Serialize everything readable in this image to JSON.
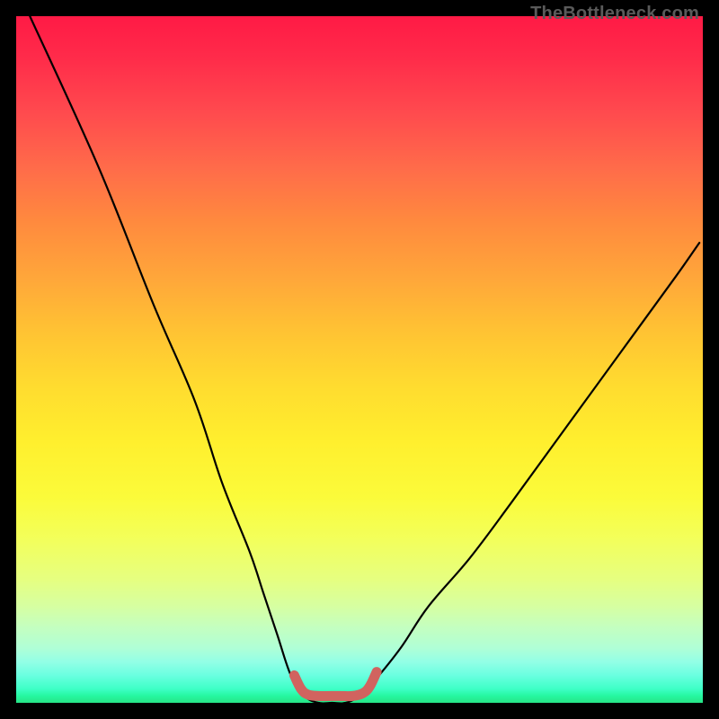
{
  "watermark": "TheBottleneck.com",
  "chart_data": {
    "type": "line",
    "title": "",
    "xlabel": "",
    "ylabel": "",
    "xlim": [
      0,
      100
    ],
    "ylim": [
      0,
      100
    ],
    "grid": false,
    "series": [
      {
        "name": "bottleneck-curve",
        "x": [
          2,
          12,
          20,
          26,
          30,
          34,
          36,
          38,
          40,
          42,
          44,
          46,
          48,
          50,
          52,
          56,
          60,
          66,
          72,
          80,
          88,
          96,
          99.5
        ],
        "y": [
          100,
          78,
          58,
          44,
          32,
          22,
          16,
          10,
          4,
          1,
          0,
          0,
          0,
          1,
          3,
          8,
          14,
          21,
          29,
          40,
          51,
          62,
          67
        ]
      },
      {
        "name": "optimal-range",
        "x": [
          40.5,
          41.5,
          42.5,
          44,
          47,
          49,
          50.5,
          51.5,
          52.5
        ],
        "y": [
          4,
          2,
          1.2,
          1,
          1,
          1,
          1.4,
          2.4,
          4.5
        ]
      }
    ],
    "colors": {
      "curve": "#000000",
      "optimal": "#d1635f"
    }
  }
}
